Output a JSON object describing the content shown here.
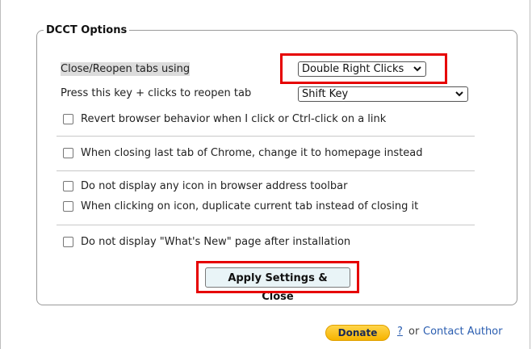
{
  "section": {
    "legend": "DCCT Options"
  },
  "close_reopen": {
    "label": "Close/Reopen tabs using",
    "selected": "Double Right Clicks"
  },
  "reopen_key": {
    "label": "Press this key + clicks to reopen tab",
    "selected": "Shift Key"
  },
  "checkboxes": [
    {
      "label": "Revert browser behavior when I click or Ctrl-click on a link",
      "checked": false
    },
    {
      "label": "When closing last tab of Chrome, change it to homepage instead",
      "checked": false
    },
    {
      "label": "Do not display any icon in browser address toolbar",
      "checked": false
    },
    {
      "label": "When clicking on icon, duplicate current tab instead of closing it",
      "checked": false
    },
    {
      "label": "Do not display \"What's New\" page after installation",
      "checked": false
    }
  ],
  "apply_button": {
    "label": "Apply Settings & Close"
  },
  "footer": {
    "donate_label": "Donate",
    "help_link": "?",
    "separator": "or",
    "contact_link": "Contact Author"
  },
  "colors": {
    "highlight_box": "#e60000",
    "donate_button": "#f6b300",
    "link": "#2a5db0"
  }
}
